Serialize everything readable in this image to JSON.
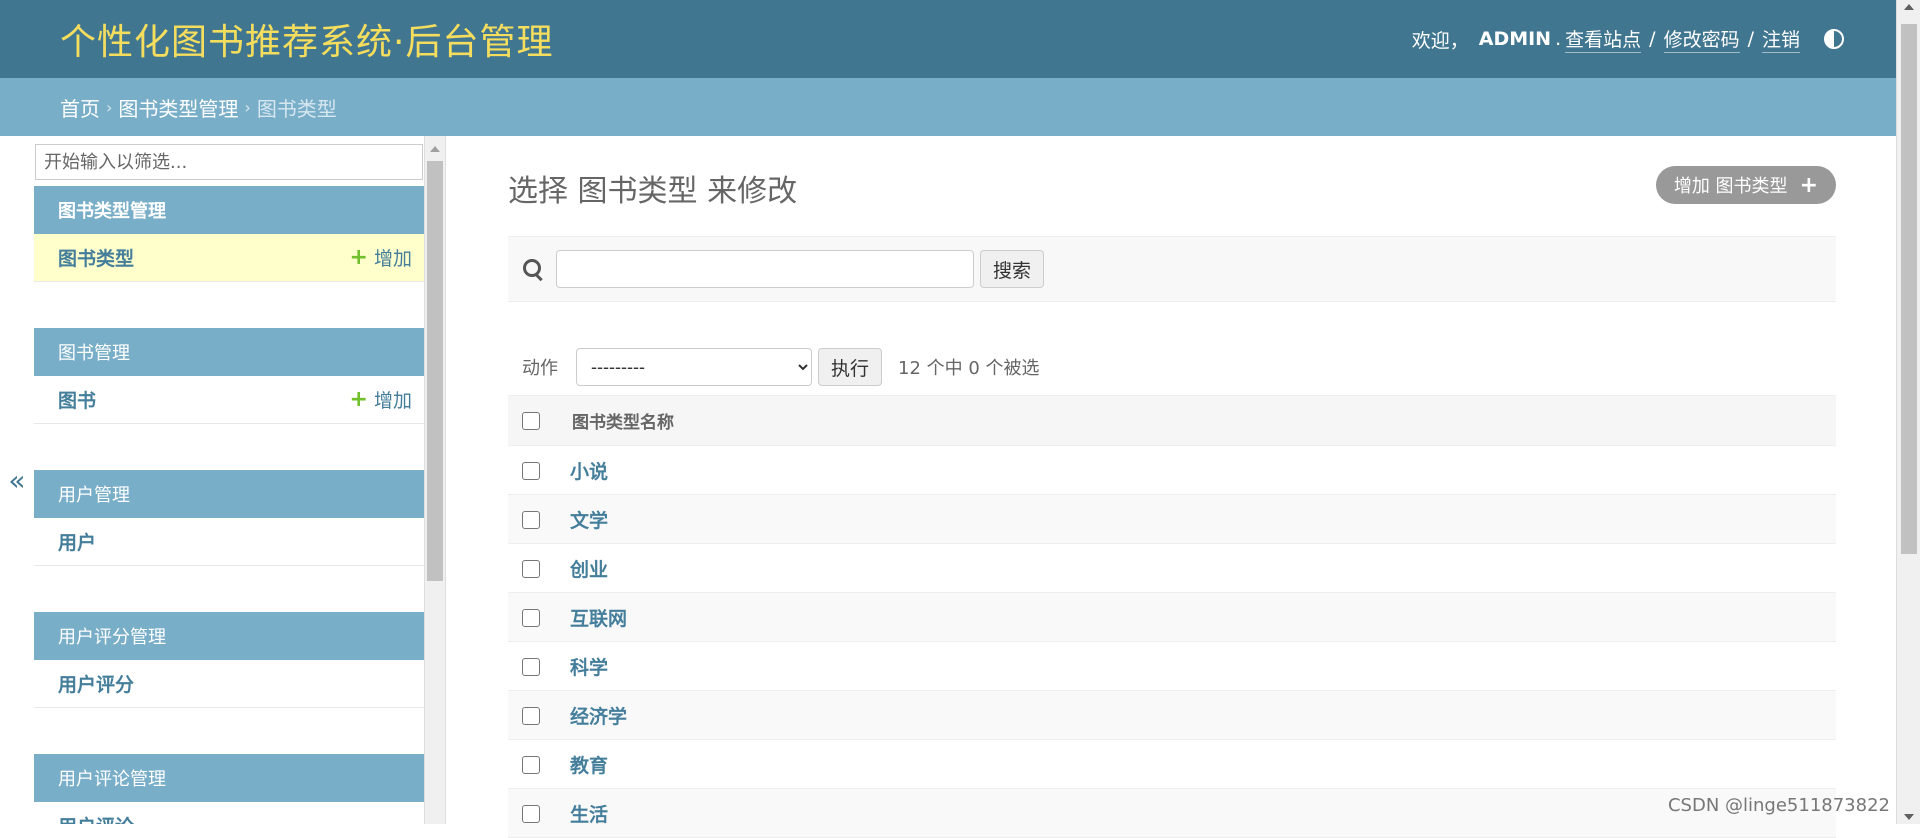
{
  "header": {
    "site_name": "个性化图书推荐系统·后台管理",
    "welcome": "欢迎，",
    "username": "ADMIN",
    "period": ".",
    "view_site": "查看站点",
    "change_password": "修改密码",
    "logout": "注销",
    "separator": "/"
  },
  "breadcrumbs": {
    "home": "首页",
    "app": "图书类型管理",
    "current": "图书类型",
    "arrow": "›"
  },
  "sidebar": {
    "toggle": "«",
    "filter_placeholder": "开始输入以筛选...",
    "modules": [
      {
        "caption": "图书类型管理",
        "model": "图书类型",
        "add": "增加"
      },
      {
        "caption": "图书管理",
        "model": "图书",
        "add": "增加"
      },
      {
        "caption": "用户管理",
        "model": "用户"
      },
      {
        "caption": "用户评分管理",
        "model": "用户评分"
      },
      {
        "caption": "用户评论管理",
        "model": "用户评论"
      }
    ]
  },
  "content": {
    "title": "选择 图书类型 来修改",
    "add_button": "增加 图书类型",
    "search_button": "搜索",
    "search_value": "",
    "actions_label": "动作",
    "actions_selected": "---------",
    "go_button": "执行",
    "counter": "12 个中 0 个被选",
    "column_header": "图书类型名称",
    "rows": [
      "小说",
      "文学",
      "创业",
      "互联网",
      "科学",
      "经济学",
      "教育",
      "生活"
    ]
  },
  "watermark": "CSDN @linge511873822",
  "colors": {
    "header_bg": "#417690",
    "site_name": "#f5dd5d",
    "breadcrumbs_bg": "#79aec8",
    "link": "#447e9b",
    "add_plus": "#70bf2b",
    "current_row_bg": "#ffffcc"
  }
}
